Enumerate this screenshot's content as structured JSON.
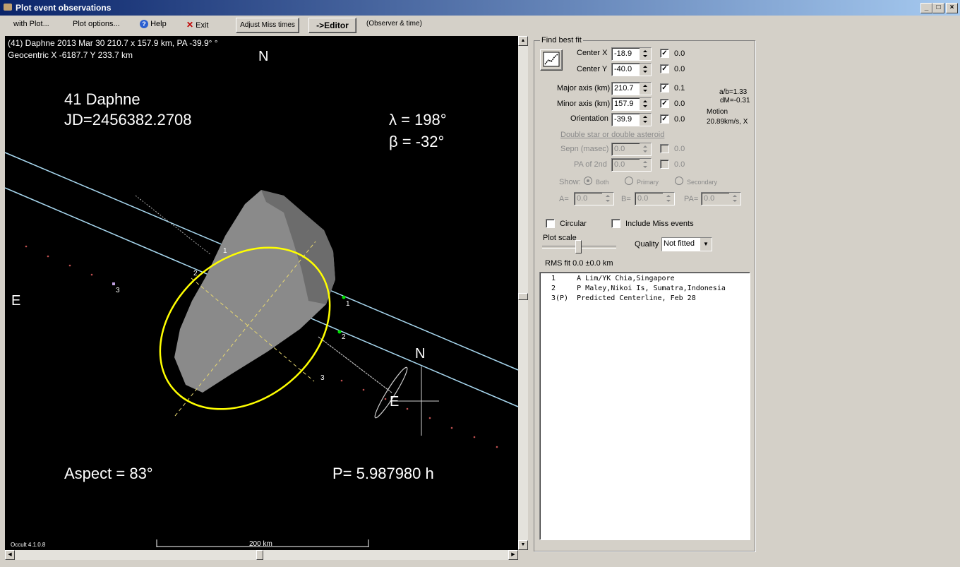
{
  "window": {
    "title": "Plot event observations",
    "min": "_",
    "max": "□",
    "close": "×"
  },
  "menu": {
    "with_plot": "with Plot...",
    "plot_options": "Plot options...",
    "help": "Help",
    "exit": "Exit",
    "adjust_miss_times": "Adjust Miss times",
    "editor": "->Editor",
    "observer_time": "(Observer & time)"
  },
  "plot": {
    "header_line1": "(41) Daphne  2013 Mar 30   210.7 x 157.9 km, PA -39.9° °",
    "header_line2": "Geocentric X -6187.7  Y 233.7 km",
    "north_top": "N",
    "east_left": "E",
    "name": "41 Daphne",
    "jd": "JD=2456382.2708",
    "lambda": "λ =  198°",
    "beta": "β =  -32°",
    "aspect": "Aspect = 83°",
    "period": "P= 5.987980 h",
    "inset_north": "N",
    "inset_east": "E",
    "version": "Occult 4.1.0.8",
    "scale_label": "200 km",
    "chord_labels": [
      "1",
      "2",
      "3"
    ]
  },
  "fit": {
    "group_title": "Find best fit",
    "center_x": {
      "label": "Center X",
      "value": "-18.9",
      "checked": true,
      "err": "0.0"
    },
    "center_y": {
      "label": "Center Y",
      "value": "-40.0",
      "checked": true,
      "err": "0.0"
    },
    "major": {
      "label": "Major axis (km)",
      "value": "210.7",
      "checked": true,
      "err": "0.1"
    },
    "minor": {
      "label": "Minor axis (km)",
      "value": "157.9",
      "checked": true,
      "err": "0.0"
    },
    "orientation": {
      "label": "Orientation",
      "value": "-39.9",
      "checked": true,
      "err": "0.0"
    },
    "ab": "a/b=1.33",
    "dm": "dM=-0.31",
    "motion_label": "Motion",
    "motion_value": "20.89km/s, X",
    "double_title": "Double star  or  double asteroid",
    "sepn": {
      "label": "Sepn (masec)",
      "value": "0.0",
      "err": "0.0"
    },
    "pa2": {
      "label": "PA of 2nd",
      "value": "0.0",
      "err": "0.0"
    },
    "show_label": "Show:",
    "show_both": "Both",
    "show_primary": "Primary",
    "show_secondary": "Secondary",
    "a_label": "A=",
    "a_value": "0.0",
    "b_label": "B=",
    "b_value": "0.0",
    "pa_label": "PA=",
    "pa_value": "0.0",
    "circular": "Circular",
    "include_miss": "Include Miss events",
    "plot_scale": "Plot scale",
    "quality_label": "Quality",
    "quality_value": "Not fitted",
    "rms": "RMS fit 0.0 ±0.0 km"
  },
  "observers": [
    {
      "num": "1   ",
      "name": "A Lim/YK Chia,Singapore"
    },
    {
      "num": "2   ",
      "name": "P Maley,Nikoi Is, Sumatra,Indonesia"
    },
    {
      "num": "3(P)",
      "name": "Predicted Centerline, Feb 28"
    }
  ],
  "colors": {
    "ellipse": "#ffff00",
    "chord": "#a8d8f0",
    "background": "#000000"
  }
}
